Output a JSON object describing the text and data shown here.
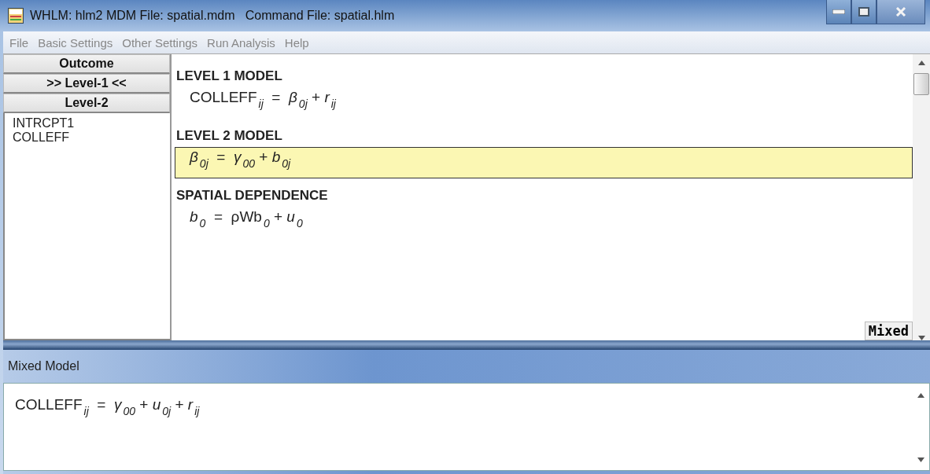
{
  "window": {
    "title": "WHLM: hlm2 MDM File: spatial.mdm   Command File: spatial.hlm"
  },
  "menu": [
    "File",
    "Basic Settings",
    "Other Settings",
    "Run Analysis",
    "Help"
  ],
  "sidebar": {
    "buttons": [
      {
        "label": "Outcome"
      },
      {
        "label": ">> Level-1 <<"
      },
      {
        "label": "Level-2"
      }
    ],
    "variables": [
      "INTRCPT1",
      "COLLEFF"
    ]
  },
  "model": {
    "sections": [
      {
        "heading": "LEVEL 1 MODEL",
        "equations": [
          {
            "text": "COLLEFF$_{ij}$  =  *β*$_{0j}$ + *r*$_{ij}$",
            "selected": false
          }
        ]
      },
      {
        "heading": "LEVEL 2 MODEL",
        "equations": [
          {
            "text": "*β*$_{0j}$  =  *γ*$_{00}$ + *b*$_{0j}$",
            "selected": true
          }
        ]
      },
      {
        "heading": "SPATIAL DEPENDENCE",
        "equations": [
          {
            "text": "*b*$_{0}$  =  ρWb$_{0}$ + *u*$_{0}$",
            "selected": false
          }
        ]
      }
    ],
    "view_button": "Mixed"
  },
  "mixed_panel": {
    "title": "Mixed Model",
    "equation": "COLLEFF$_{ij}$  =  *γ*$_{00}$ + *u*$_{0j}$ + *r*$_{ij}$"
  }
}
